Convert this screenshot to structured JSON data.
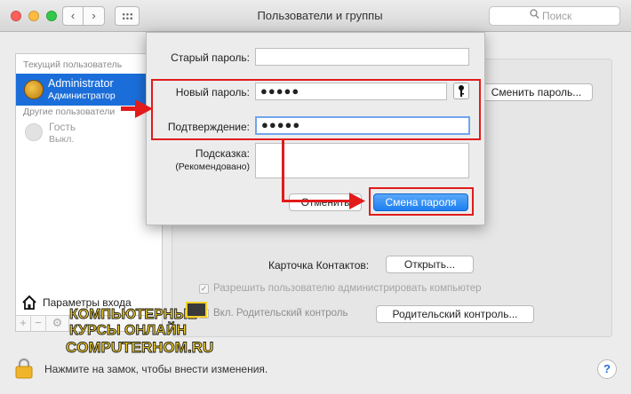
{
  "window": {
    "title": "Пользователи и группы",
    "search_placeholder": "Поиск",
    "nav_back": "‹",
    "nav_forward": "›"
  },
  "sidebar": {
    "current_user_header": "Текущий пользователь",
    "current_user": {
      "name": "Administrator",
      "role": "Администратор"
    },
    "other_users_header": "Другие пользователи",
    "guest": {
      "name": "Гость",
      "status": "Выкл."
    },
    "login_options_label": "Параметры входа",
    "add_label": "+",
    "remove_label": "−",
    "gear_label": "⚙"
  },
  "main": {
    "change_password_button": "Сменить пароль...",
    "contacts_card_label": "Карточка Контактов:",
    "open_button": "Открыть...",
    "allow_admin_label": "Разрешить пользователю администрировать компьютер",
    "allow_admin_checked": true,
    "parental_checkbox_label": "Вкл. Родительский контроль",
    "parental_checked": false,
    "parental_button": "Родительский контроль..."
  },
  "sheet": {
    "old_password_label": "Старый пароль:",
    "old_password_value": "",
    "new_password_label": "Новый пароль:",
    "new_password_value": "●●●●●",
    "confirm_label": "Подтверждение:",
    "confirm_value": "●●●●●",
    "hint_label": "Подсказка:",
    "hint_sublabel": "(Рекомендовано)",
    "hint_value": "",
    "cancel_button": "Отменить",
    "submit_button": "Смена пароля"
  },
  "bottom": {
    "lock_text": "Нажмите на замок, чтобы внести изменения.",
    "help_label": "?"
  },
  "watermark": {
    "line1": "КОМПЬЮТЕРНЫЕ",
    "line2": "КУРСЫ  ОНЛАЙН",
    "line3": "COMPUTERHOM.RU"
  },
  "colors": {
    "accent_blue": "#1b6ed9",
    "annotation_red": "#e21b1b",
    "watermark_yellow": "#f5d12a"
  }
}
